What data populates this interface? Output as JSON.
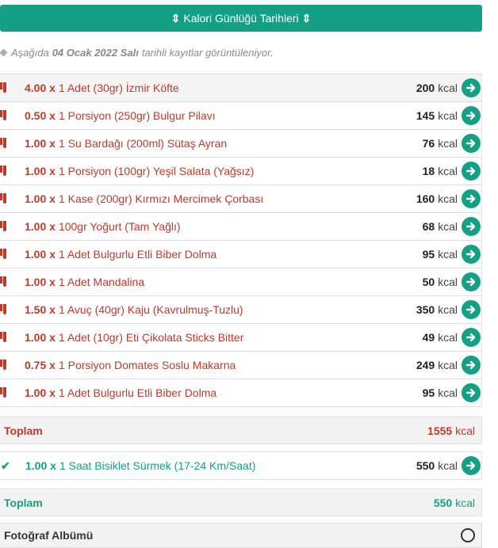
{
  "header": {
    "title": "Kalori Günlüğü Tarihleri",
    "arrow_left": "⇕",
    "arrow_right": "⇕"
  },
  "info": {
    "prefix": "Aşağıda",
    "date": "04 Ocak 2022 Salı",
    "suffix": "tarihli kayıtlar görüntüleniyor."
  },
  "foods": [
    {
      "qty": "4.00 x",
      "desc": "1 Adet (30gr) İzmir Köfte",
      "kcal": "200",
      "unit": "kcal"
    },
    {
      "qty": "0.50 x",
      "desc": "1 Porsiyon (250gr) Bulgur Pilavı",
      "kcal": "145",
      "unit": "kcal"
    },
    {
      "qty": "1.00 x",
      "desc": "1 Su Bardağı (200ml) Sütaş Ayran",
      "kcal": "76",
      "unit": "kcal"
    },
    {
      "qty": "1.00 x",
      "desc": "1 Porsiyon (100gr) Yeşil Salata (Yağsız)",
      "kcal": "18",
      "unit": "kcal"
    },
    {
      "qty": "1.00 x",
      "desc": "1 Kase (200gr) Kırmızı Mercimek Çorbası",
      "kcal": "160",
      "unit": "kcal"
    },
    {
      "qty": "1.00 x",
      "desc": "100gr Yoğurt (Tam Yağlı)",
      "kcal": "68",
      "unit": "kcal"
    },
    {
      "qty": "1.00 x",
      "desc": "1 Adet Bulgurlu Etli Biber Dolma",
      "kcal": "95",
      "unit": "kcal"
    },
    {
      "qty": "1.00 x",
      "desc": "1 Adet Mandalina",
      "kcal": "50",
      "unit": "kcal"
    },
    {
      "qty": "1.50 x",
      "desc": "1 Avuç (40gr) Kaju (Kavrulmuş-Tuzlu)",
      "kcal": "350",
      "unit": "kcal"
    },
    {
      "qty": "1.00 x",
      "desc": "1 Adet (10gr) Eti Çikolata Sticks Bitter",
      "kcal": "49",
      "unit": "kcal"
    },
    {
      "qty": "0.75 x",
      "desc": "1 Porsiyon Domates Soslu Makarna",
      "kcal": "249",
      "unit": "kcal"
    },
    {
      "qty": "1.00 x",
      "desc": "1 Adet Bulgurlu Etli Biber Dolma",
      "kcal": "95",
      "unit": "kcal"
    }
  ],
  "food_total": {
    "label": "Toplam",
    "value": "1555",
    "unit": "kcal"
  },
  "exercise": {
    "check": "✔",
    "qty": "1.00 x",
    "desc": "1 Saat Bisiklet Sürmek (17-24 Km/Saat)",
    "kcal": "550",
    "unit": "kcal"
  },
  "exercise_total": {
    "label": "Toplam",
    "value": "550",
    "unit": "kcal"
  },
  "album": {
    "label": "Fotoğraf Albümü"
  },
  "colors": {
    "accent": "#14a085",
    "danger": "#c0392b"
  }
}
